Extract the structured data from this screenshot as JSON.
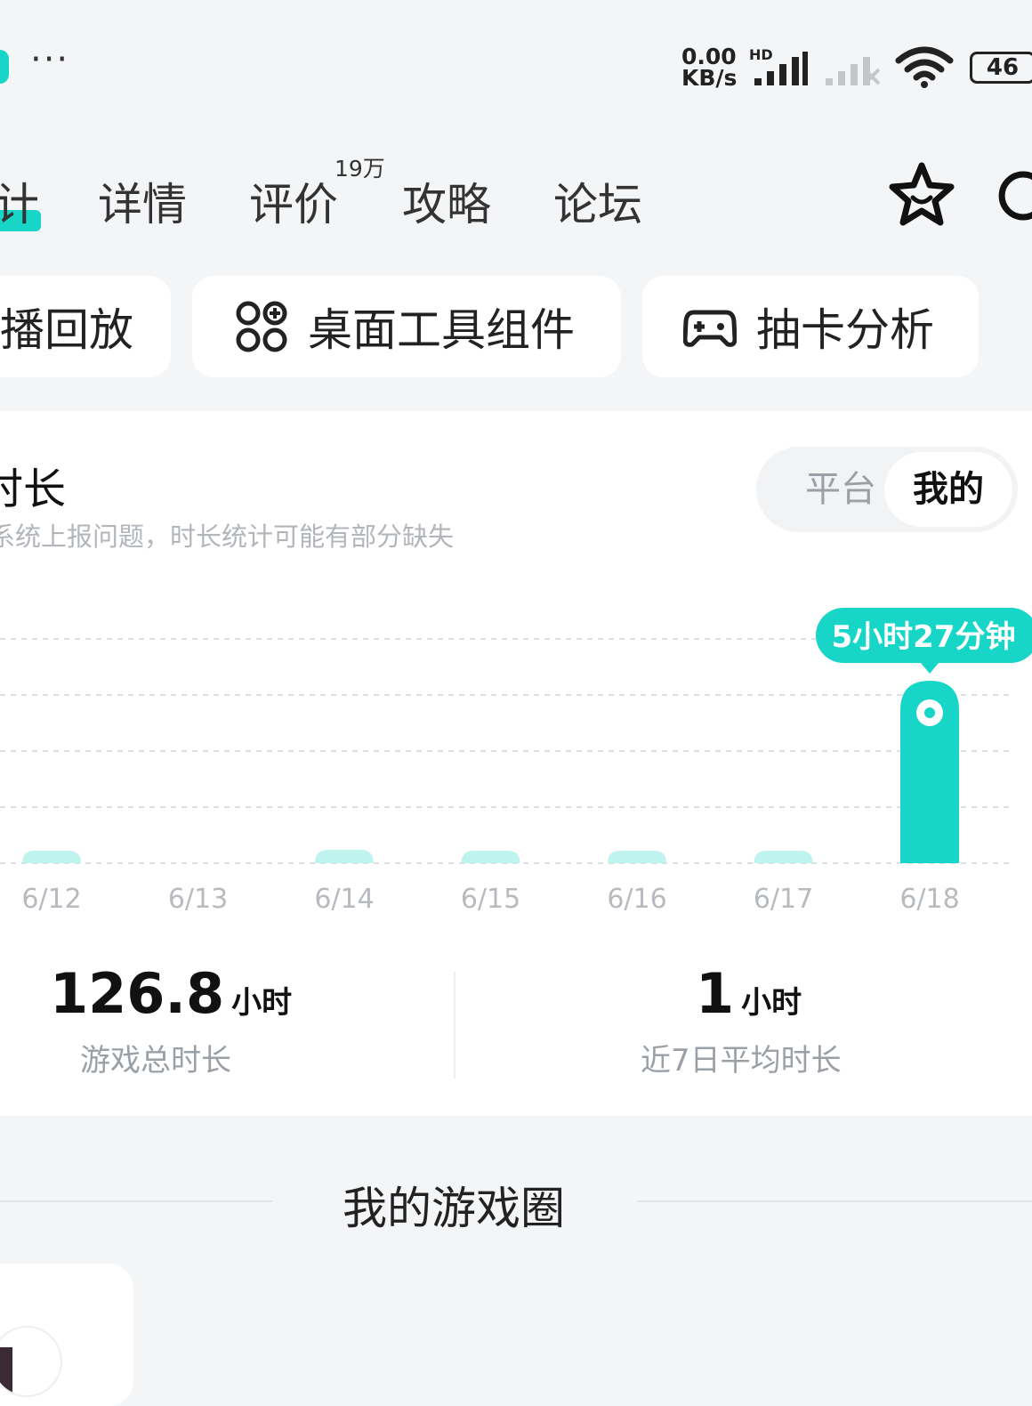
{
  "status_bar": {
    "speed_value": "0.00",
    "speed_unit": "KB/s",
    "network_type": "HD",
    "battery": "46",
    "menu_dots": "···"
  },
  "tabs": {
    "items": [
      {
        "label": "计",
        "active": true
      },
      {
        "label": "详情",
        "active": false
      },
      {
        "label": "评价",
        "active": false,
        "badge": "19万"
      },
      {
        "label": "攻略",
        "active": false
      },
      {
        "label": "论坛",
        "active": false
      }
    ]
  },
  "tools": [
    {
      "label": "播回放",
      "icon": "replay-icon"
    },
    {
      "label": "桌面工具组件",
      "icon": "widget-icon"
    },
    {
      "label": "抽卡分析",
      "icon": "gamepad-icon"
    }
  ],
  "playtime": {
    "title": "时长",
    "note": "系统上报问题，时长统计可能有部分缺失",
    "segment": {
      "platform": "平台",
      "mine": "我的",
      "selected": "mine"
    },
    "tooltip": "5小时27分钟",
    "accent_color": "#17d6c8",
    "faint_color": "#bff3ee"
  },
  "chart_data": {
    "type": "bar",
    "categories": [
      "6/12",
      "6/13",
      "6/14",
      "6/15",
      "6/16",
      "6/17",
      "6/18"
    ],
    "values": [
      0.2,
      0,
      0.4,
      0.2,
      0.2,
      0.2,
      5.45
    ],
    "ylim": [
      0,
      6.7
    ],
    "grid": true,
    "highlight_index": 6
  },
  "stats": {
    "total_value": "126.8",
    "total_unit": "小时",
    "total_label": "游戏总时长",
    "avg_value": "1",
    "avg_unit": "小时",
    "avg_label": "近7日平均时长"
  },
  "game_circle": {
    "title": "我的游戏圈"
  }
}
